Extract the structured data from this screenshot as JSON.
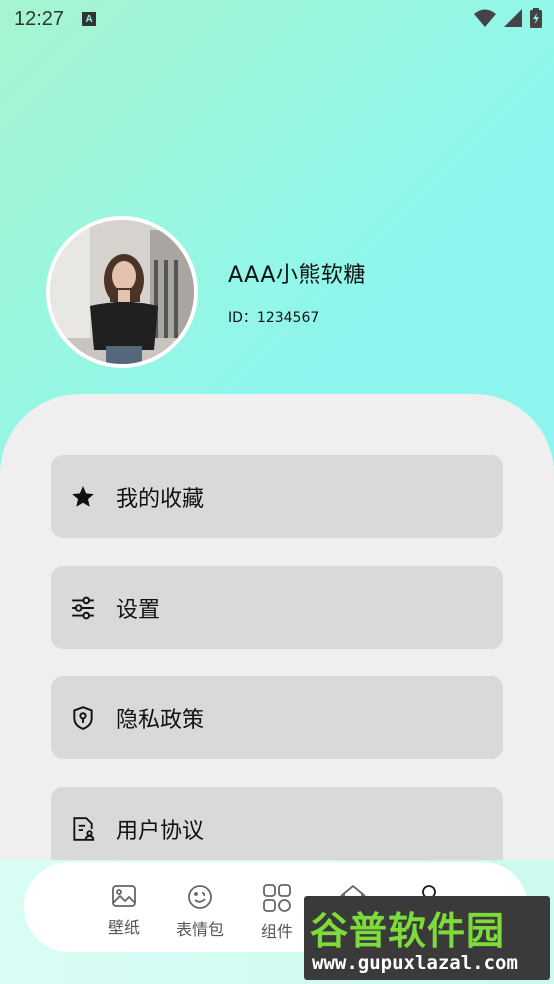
{
  "status_bar": {
    "time": "12:27",
    "notification_letter": "A"
  },
  "profile": {
    "name": "AAA小熊软糖",
    "id": "ID：1234567"
  },
  "menu": [
    {
      "label": "我的收藏",
      "icon": "star-icon"
    },
    {
      "label": "设置",
      "icon": "sliders-icon"
    },
    {
      "label": "隐私政策",
      "icon": "shield-icon"
    },
    {
      "label": "用户协议",
      "icon": "document-user-icon"
    }
  ],
  "tabs": [
    {
      "label": "壁纸",
      "icon": "image-icon"
    },
    {
      "label": "表情包",
      "icon": "emoji-icon"
    },
    {
      "label": "组件",
      "icon": "grid-icon"
    },
    {
      "label": "",
      "icon": "home-icon"
    },
    {
      "label": "",
      "icon": "person-icon",
      "active": true
    }
  ],
  "watermark": {
    "title": "谷普软件园",
    "url": "www.gupuxlazal.com"
  },
  "colors": {
    "sheet": "#efefef",
    "menu_item": "#d9d9d9",
    "watermark_green": "#7ddc3a"
  }
}
